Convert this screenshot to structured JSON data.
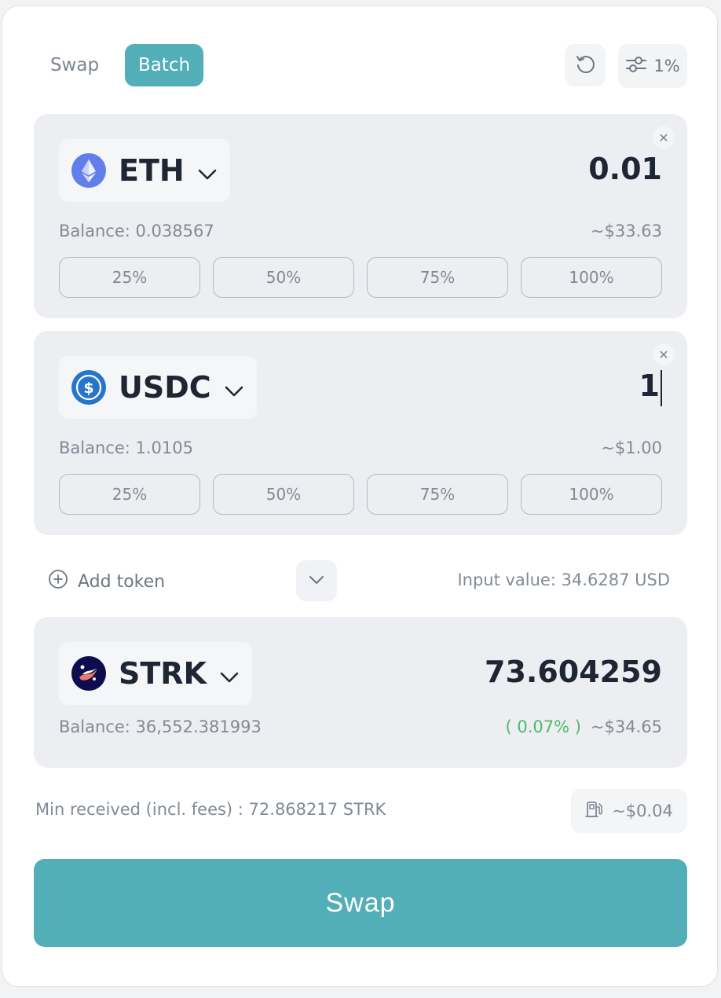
{
  "header": {
    "tabs": [
      {
        "label": "Swap",
        "active": false
      },
      {
        "label": "Batch",
        "active": true
      }
    ],
    "slippage": "1%"
  },
  "inputs": [
    {
      "token": "ETH",
      "amount": "0.01",
      "balance": "Balance: 0.038567",
      "usd_value": "~$33.63",
      "percent_buttons": [
        "25%",
        "50%",
        "75%",
        "100%"
      ]
    },
    {
      "token": "USDC",
      "amount": "1",
      "balance": "Balance: 1.0105",
      "usd_value": "~$1.00",
      "percent_buttons": [
        "25%",
        "50%",
        "75%",
        "100%"
      ]
    }
  ],
  "middle": {
    "add_token_label": "Add token",
    "input_value": "Input value: 34.6287 USD"
  },
  "output": {
    "token": "STRK",
    "amount": "73.604259",
    "balance": "Balance: 36,552.381993",
    "price_impact": "( 0.07% )",
    "usd_value": "~$34.65"
  },
  "footer": {
    "min_received": "Min received (incl. fees) : 72.868217 STRK",
    "gas_fee": "~$0.04",
    "swap_button": "Swap"
  },
  "colors": {
    "accent": "#52aeb7",
    "panel": "#eceef2",
    "positive": "#4cba6a",
    "eth": "#627eea",
    "usdc": "#2775ca",
    "strk": "#0c0c4f"
  },
  "icons": {
    "refresh": "refresh-icon",
    "settings": "sliders-icon",
    "close": "close-icon",
    "dropdown": "chevron-down-icon",
    "add": "plus-circle-icon",
    "gas": "gas-pump-icon"
  }
}
